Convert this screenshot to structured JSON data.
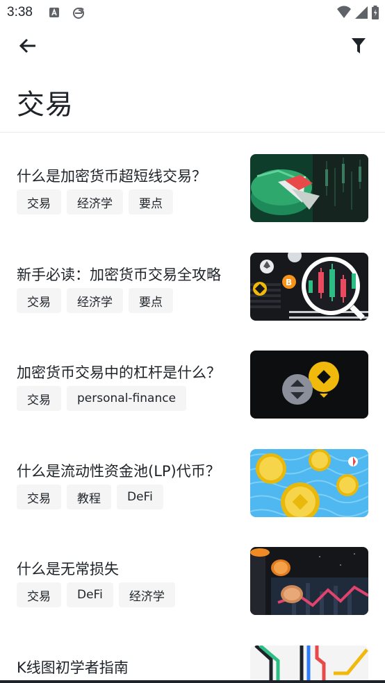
{
  "status_bar": {
    "time": "3:38"
  },
  "header": {
    "title": "交易"
  },
  "articles": [
    {
      "title": "什么是加密货币超短线交易？",
      "tags": [
        "交易",
        "经济学",
        "要点"
      ]
    },
    {
      "title": "新手必读：加密货币交易全攻略",
      "tags": [
        "交易",
        "经济学",
        "要点"
      ]
    },
    {
      "title": "加密货币交易中的杠杆是什么？",
      "tags": [
        "交易",
        "personal-finance"
      ]
    },
    {
      "title": "什么是流动性资金池(LP)代币？",
      "tags": [
        "交易",
        "教程",
        "DeFi"
      ]
    },
    {
      "title": "什么是无常损失",
      "tags": [
        "交易",
        "DeFi",
        "经济学"
      ]
    },
    {
      "title": "K线图初学者指南",
      "tags": []
    }
  ]
}
